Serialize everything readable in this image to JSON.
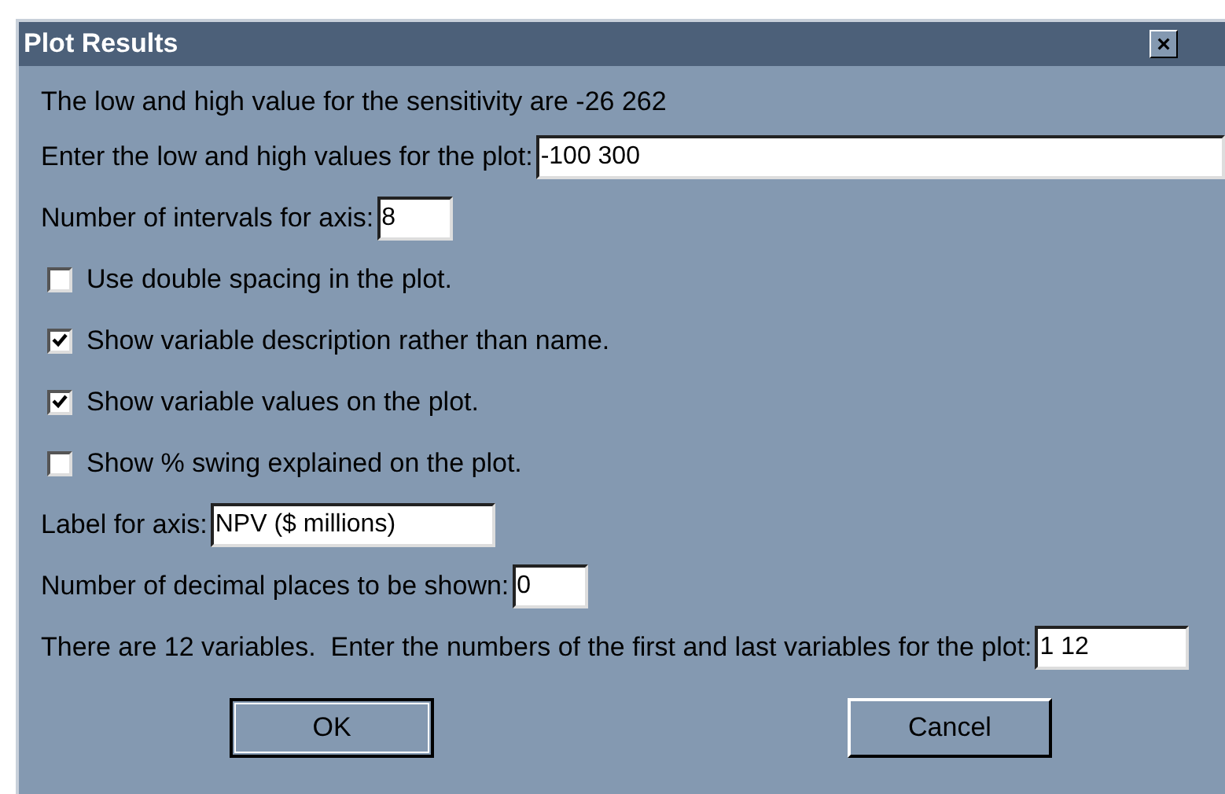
{
  "window": {
    "title": "Plot Results",
    "close": "×"
  },
  "rows": [
    {
      "kind": "text",
      "text": "The low and high value for the sensitivity are -26 262"
    },
    {
      "kind": "input",
      "label": "Enter the low and high values for the plot:",
      "value": "-100 300"
    },
    {
      "kind": "input",
      "label": "Number of intervals for axis:",
      "value": "8"
    },
    {
      "kind": "checkbox",
      "label": "Use double spacing in the plot.",
      "checked": false
    },
    {
      "kind": "checkbox",
      "label": "Show variable description rather than name.",
      "checked": true
    },
    {
      "kind": "checkbox",
      "label": "Show variable values on the plot.",
      "checked": true
    },
    {
      "kind": "checkbox",
      "label": "Show % swing explained on the plot.",
      "checked": false
    },
    {
      "kind": "input",
      "label": "Label for axis:",
      "value": "NPV ($ millions)"
    },
    {
      "kind": "input",
      "label": "Number of decimal places to be shown:",
      "value": "0"
    },
    {
      "kind": "input",
      "label": "There are 12 variables.  Enter the numbers of the first and last variables for the plot:",
      "value": "1 12"
    }
  ],
  "buttons": [
    {
      "label": "OK",
      "default": true
    },
    {
      "label": "Cancel",
      "default": false
    }
  ]
}
